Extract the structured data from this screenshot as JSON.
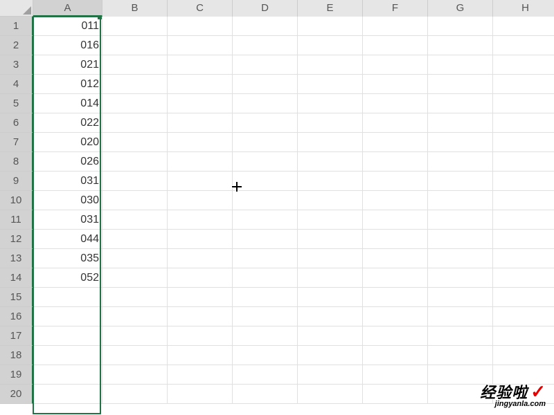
{
  "columns": [
    "A",
    "B",
    "C",
    "D",
    "E",
    "F",
    "G",
    "H"
  ],
  "selected_column": "A",
  "total_rows": 20,
  "cells": {
    "A1": "011",
    "A2": "016",
    "A3": "021",
    "A4": "012",
    "A5": "014",
    "A6": "022",
    "A7": "020",
    "A8": "026",
    "A9": "031",
    "A10": "030",
    "A11": "031",
    "A12": "044",
    "A13": "035",
    "A14": "052"
  },
  "watermark": {
    "main_text": "经验啦",
    "check": "✓",
    "sub_text": "jingyanla.com"
  }
}
